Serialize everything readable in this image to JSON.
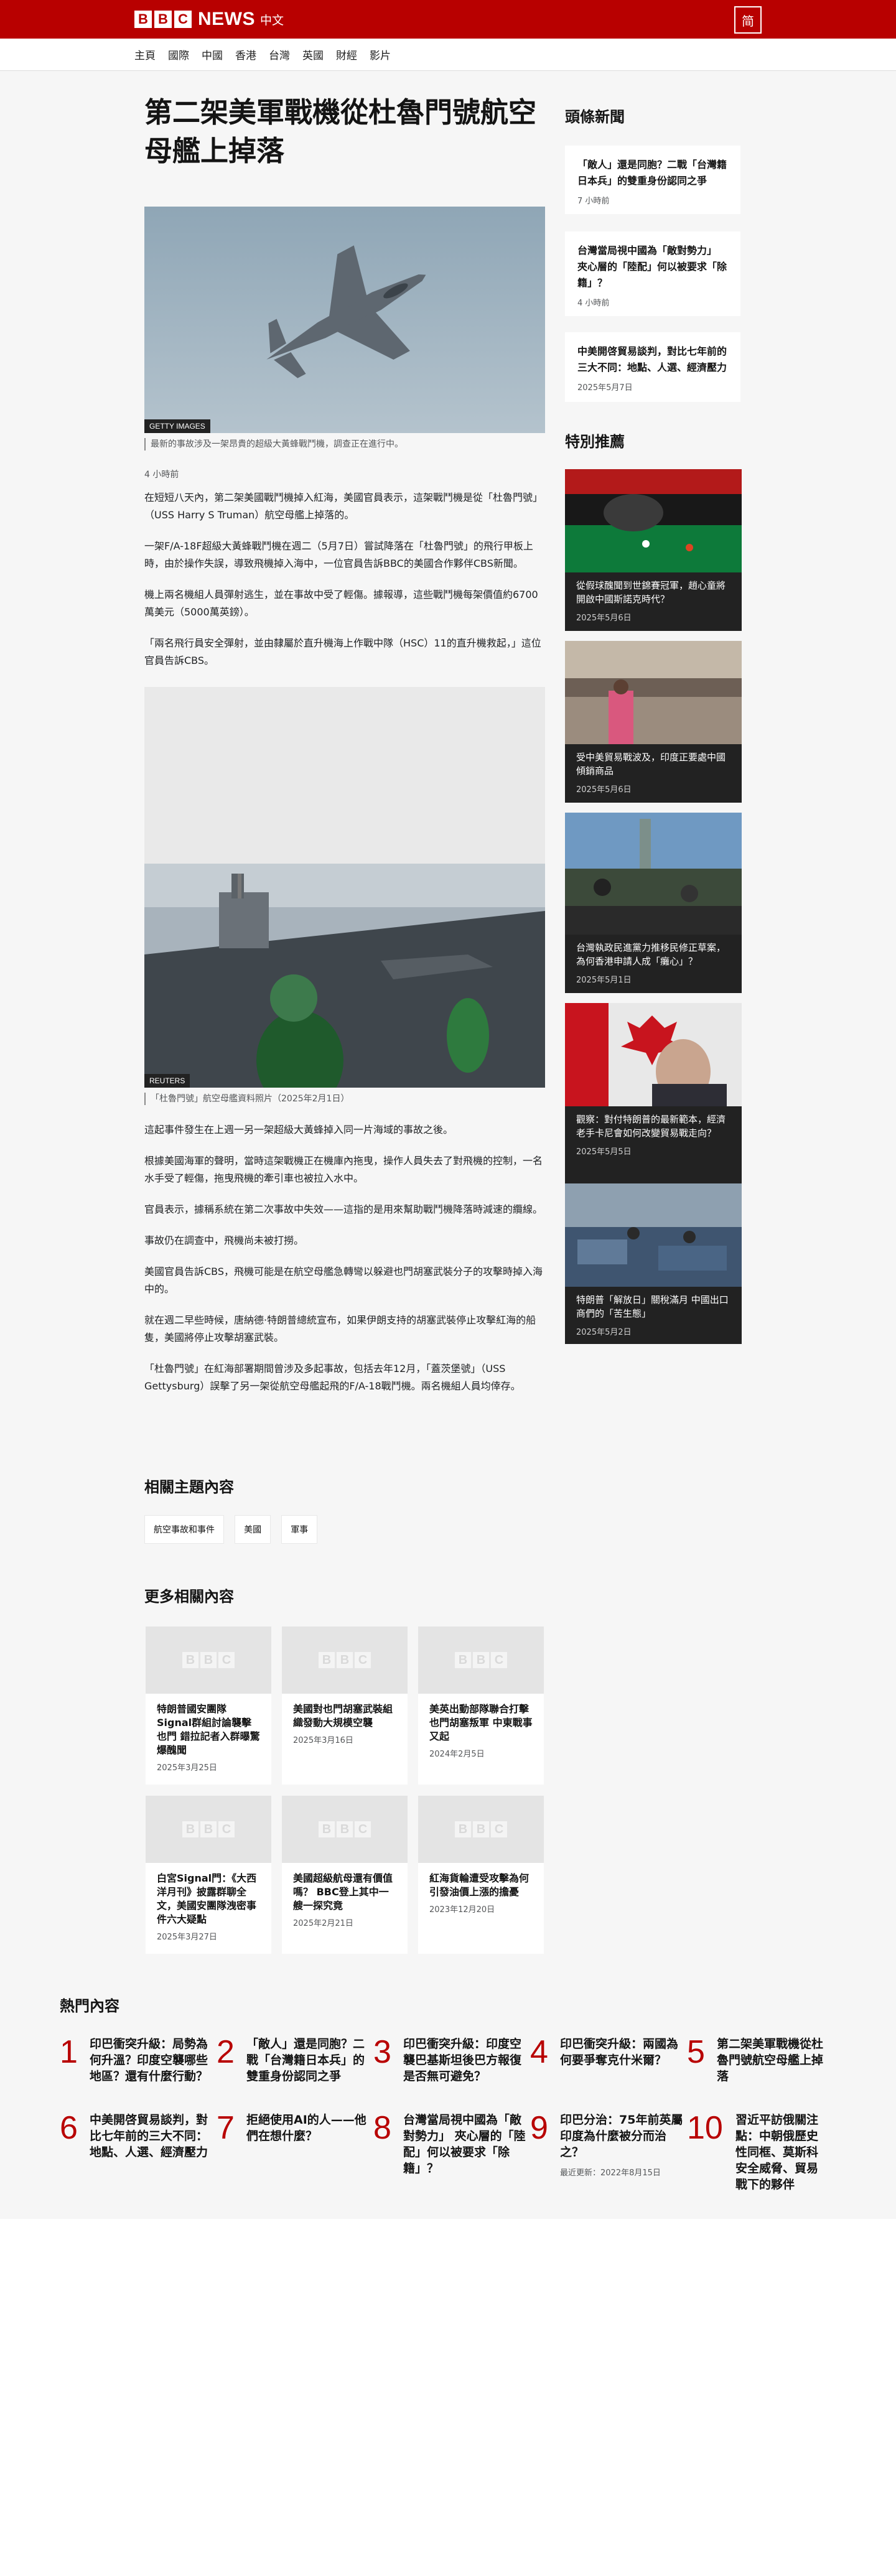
{
  "header": {
    "logo_letters": [
      "B",
      "B",
      "C"
    ],
    "brand": "NEWS",
    "language": "中文",
    "switch_label": "简"
  },
  "nav": [
    "主頁",
    "國際",
    "中國",
    "香港",
    "台灣",
    "英國",
    "財經",
    "影片"
  ],
  "article": {
    "title": "第二架美軍戰機從杜魯門號航空母艦上掉落",
    "image1": {
      "credit": "GETTY IMAGES",
      "caption": "最新的事故涉及一架昂貴的超級大黃蜂戰鬥機，調查正在進行中。"
    },
    "time": "4 小時前",
    "paragraphs_a": [
      "在短短八天內，第二架美國戰鬥機掉入紅海，美國官員表示，這架戰鬥機是從「杜魯門號」（USS Harry S Truman）航空母艦上掉落的。",
      "一架F/A-18F超級大黃蜂戰鬥機在週二（5月7日）嘗試降落在「杜魯門號」的飛行甲板上時，由於操作失誤，導致飛機掉入海中，一位官員告訴BBC的美國合作夥伴CBS新聞。",
      "機上兩名機組人員彈射逃生，並在事故中受了輕傷。據報導，這些戰鬥機每架價值約6700萬美元（5000萬英鎊）。",
      "「兩名飛行員安全彈射，並由隸屬於直升機海上作戰中隊（HSC）11的直升機救起，」這位官員告訴CBS。"
    ],
    "image2": {
      "credit": "REUTERS",
      "caption": "「杜魯門號」航空母艦資料照片（2025年2月1日）"
    },
    "paragraphs_b": [
      "這起事件發生在上週一另一架超級大黃蜂掉入同一片海域的事故之後。",
      "根據美國海軍的聲明，當時這架戰機正在機庫內拖曳，操作人員失去了對飛機的控制，一名水手受了輕傷，拖曳飛機的牽引車也被拉入水中。",
      "官員表示，據稱系統在第二次事故中失效——這指的是用來幫助戰鬥機降落時減速的纜線。",
      "事故仍在調查中，飛機尚未被打撈。",
      "美國官員告訴CBS，飛機可能是在航空母艦急轉彎以躲避也門胡塞武裝分子的攻擊時掉入海中的。",
      "就在週二早些時候，唐納德·特朗普總統宣布，如果伊朗支持的胡塞武裝停止攻擊紅海的船隻，美國將停止攻擊胡塞武裝。",
      "「杜魯門號」在紅海部署期間曾涉及多起事故，包括去年12月，「蓋茨堡號」（USS Gettysburg）誤擊了另一架從航空母艦起飛的F/A-18戰鬥機。兩名機組人員均倖存。"
    ]
  },
  "related_topics": {
    "heading": "相關主題內容",
    "tags": [
      "航空事故和事件",
      "美國",
      "軍事"
    ]
  },
  "more_related": {
    "heading": "更多相關內容",
    "cards": [
      {
        "title": "特朗普國安團隊Signal群組討論襲擊也門 錯拉記者入群曝驚爆醜聞",
        "date": "2025年3月25日"
      },
      {
        "title": "美國對也門胡塞武裝組織發動大規模空襲",
        "date": "2025年3月16日"
      },
      {
        "title": "美英出動部隊聯合打擊也門胡塞叛軍 中東戰事又起",
        "date": "2024年2月5日"
      },
      {
        "title": "白宮Signal門：《大西洋月刊》披露群聊全文，美國安團隊洩密事件六大疑點",
        "date": "2025年3月27日"
      },
      {
        "title": "美國超級航母還有價值嗎？ BBC登上其中一艘一探究竟",
        "date": "2025年2月21日"
      },
      {
        "title": "紅海貨輪遭受攻擊為何引發油價上漲的擔憂",
        "date": "2023年12月20日"
      }
    ]
  },
  "sidebar": {
    "top_heading": "頭條新聞",
    "top_stories": [
      {
        "title": "「敵人」還是同胞？二戰「台灣籍日本兵」的雙重身份認同之爭",
        "date": "7 小時前"
      },
      {
        "title": "台灣當局視中國為「敵對勢力」 夾心層的「陸配」何以被要求「除籍」？",
        "date": "4 小時前"
      },
      {
        "title": "中美開啓貿易談判，對比七年前的三大不同：地點、人選、經濟壓力",
        "date": "2025年5月7日"
      }
    ],
    "features_heading": "特別推薦",
    "features": [
      {
        "title": "從假球醜聞到世錦賽冠軍，趙心童將開啟中國斯諾克時代？",
        "date": "2025年5月6日"
      },
      {
        "title": "受中美貿易戰波及，印度正要處中國傾銷商品",
        "date": "2025年5月6日"
      },
      {
        "title": "台灣執政民進黨力推移民修正草案，為何香港申請人成「癱心」？",
        "date": "2025年5月1日"
      },
      {
        "title": "觀察：對付特朗普的最新範本，經濟老手卡尼會如何改變貿易戰走向？",
        "date": "2025年5月5日"
      },
      {
        "title": "特朗普「解放日」關稅滿月 中國出口商們的「苦生態」",
        "date": "2025年5月2日"
      }
    ]
  },
  "popular": {
    "heading": "熱門內容",
    "items": [
      {
        "num": "1",
        "title": "印巴衝突升級：局勢為何升溫？印度空襲哪些地區？還有什麼行動？"
      },
      {
        "num": "2",
        "title": "「敵人」還是同胞？二戰「台灣籍日本兵」的雙重身份認同之爭"
      },
      {
        "num": "3",
        "title": "印巴衝突升級：印度空襲巴基斯坦後巴方報復是否無可避免？"
      },
      {
        "num": "4",
        "title": "印巴衝突升級：兩國為何要爭奪克什米爾？"
      },
      {
        "num": "5",
        "title": "第二架美軍戰機從杜魯門號航空母艦上掉落"
      },
      {
        "num": "6",
        "title": "中美開啓貿易談判，對比七年前的三大不同：地點、人選、經濟壓力"
      },
      {
        "num": "7",
        "title": "拒絕使用AI的人——他們在想什麼？"
      },
      {
        "num": "8",
        "title": "台灣當局視中國為「敵對勢力」 夾心層的「陸配」何以被要求「除籍」？"
      },
      {
        "num": "9",
        "title": "印巴分治：75年前英屬印度為什麼被分而治之？",
        "date": "最近更新：2022年8月15日"
      },
      {
        "num": "10",
        "title": "習近平訪俄關注點：中朝俄歷史性同框、莫斯科安全威脅、貿易戰下的夥伴"
      }
    ]
  },
  "colors": {
    "brand_red": "#b80000",
    "background": "#f6f6f6",
    "card_dark": "#222222"
  }
}
